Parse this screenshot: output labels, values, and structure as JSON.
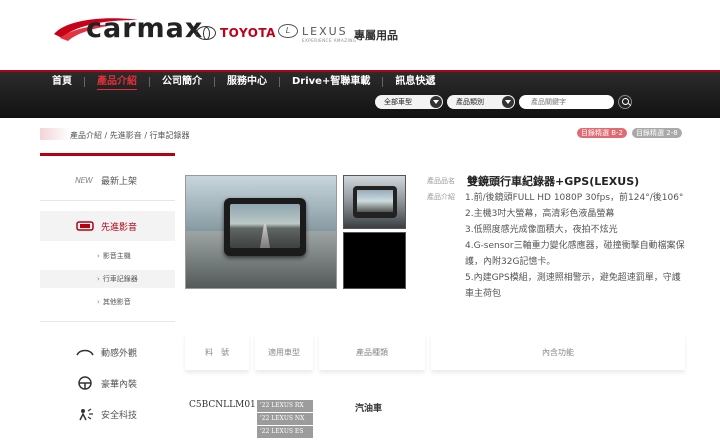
{
  "brand": {
    "logo_text": "carmax",
    "toyota": "TOYOTA",
    "lexus": "LEXUS",
    "lexus_tagline": "EXPERIENCE AMAZING",
    "exclusive": "專屬用品",
    "red": "#b50012"
  },
  "nav": {
    "items": [
      {
        "label": "首頁"
      },
      {
        "label": "產品介紹"
      },
      {
        "label": "公司簡介"
      },
      {
        "label": "服務中心"
      },
      {
        "label": "Drive+智聯車載"
      },
      {
        "label": "訊息快遞"
      }
    ],
    "active_index": 1,
    "search": {
      "car_model": "全部車型",
      "category": "產品類別",
      "keyword_placeholder": "產品關鍵字"
    }
  },
  "breadcrumb": "產品介紹 / 先進影音 / 行車記錄器",
  "badges": [
    "目錄精選 B-2",
    "目錄精選 2-8"
  ],
  "sidebar": {
    "items": [
      {
        "label": "最新上架",
        "icon": "new-icon"
      },
      {
        "label": "先進影音",
        "icon": "screen-icon",
        "active": true
      },
      {
        "label": "影音主機",
        "sub": true
      },
      {
        "label": "行車記錄器",
        "sub": true,
        "active": true
      },
      {
        "label": "其他影音",
        "sub": true
      },
      {
        "label": "動感外觀",
        "icon": "car-exterior-icon"
      },
      {
        "label": "豪華內裝",
        "icon": "steering-wheel-icon"
      },
      {
        "label": "安全科技",
        "icon": "safety-icon"
      }
    ]
  },
  "product": {
    "name_label": "產品品名",
    "desc_label": "產品介紹",
    "name": "雙鏡頭行車紀錄器+GPS(LEXUS)",
    "desc": [
      "1.前/後鏡頭FULL HD 1080P 30fps，前124°/後106°",
      "2.主機3吋大螢幕，高清彩色液晶螢幕",
      "3.低照度感光成像面積大，夜拍不炫光",
      "4.G-sensor三軸重力變化感應器，碰撞衝擊自動檔案保護，內附32G記憶卡。",
      "5.內建GPS模組，測速照相警示，避免超速罰單，守護車主荷包"
    ]
  },
  "spec_table": {
    "headers": [
      "料　號",
      "適用車型",
      "產品種類",
      "內含功能"
    ],
    "row": {
      "code": "C5BCNLLM01",
      "models": [
        "'22 LEXUS RX",
        "'22 LEXUS NX",
        "'22 LEXUS ES"
      ],
      "type": "汽油車"
    }
  }
}
